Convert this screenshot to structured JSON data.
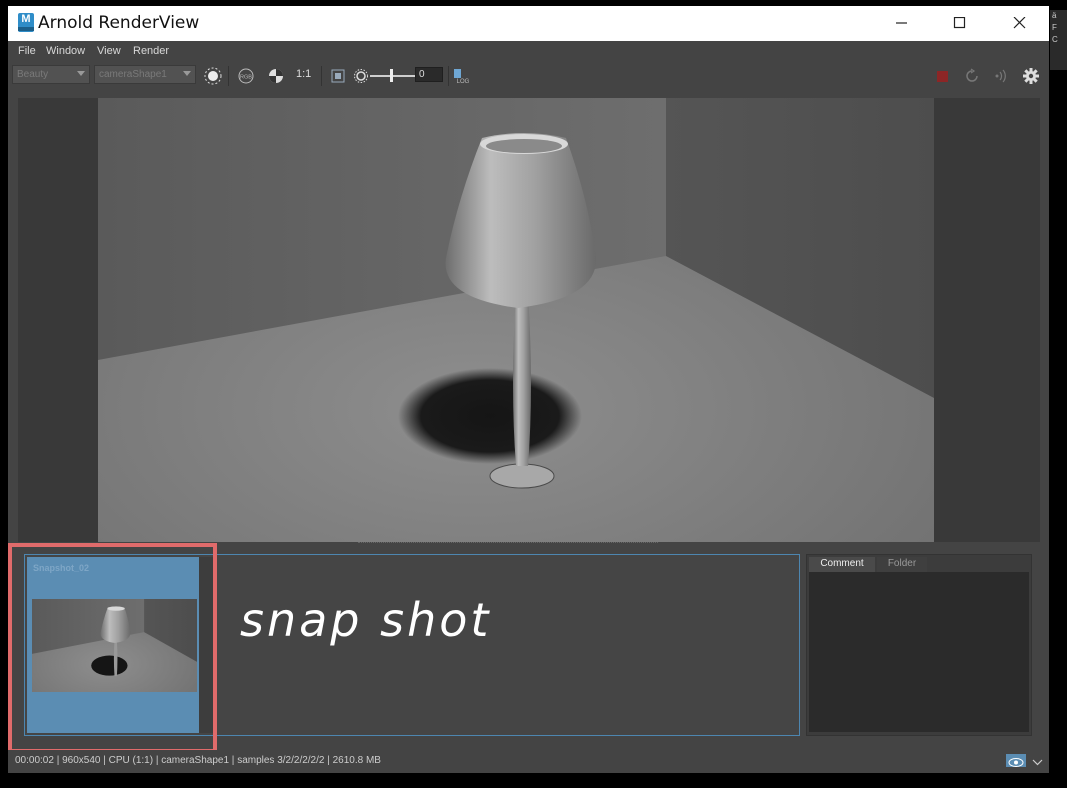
{
  "window": {
    "title": "Arnold RenderView",
    "logo_letter": "M",
    "controls": [
      "minimize-icon",
      "maximize-icon",
      "close-icon"
    ]
  },
  "menu": [
    "File",
    "Window",
    "View",
    "Render"
  ],
  "toolbar": {
    "aov_select": "Beauty",
    "camera_select": "cameraShape1",
    "zoom_label": "1:1",
    "exposure_value": "0",
    "log_label": "LOG",
    "icons": [
      "crop-region-icon",
      "rgb-channel-icon",
      "checker-icon",
      "fit-frame-icon",
      "exposure-icon",
      "log-icon",
      "stop-render-icon",
      "refresh-icon",
      "ipr-icon",
      "gear-icon"
    ]
  },
  "snapshots": {
    "items": [
      {
        "label": "Snapshot_02"
      }
    ],
    "annotation": "snap shot"
  },
  "side_panel": {
    "tabs": [
      "Comment",
      "Folder"
    ],
    "active_tab": "Comment"
  },
  "status": {
    "text": "00:00:02 |  960x540 | CPU (1:1) | cameraShape1 | samples 3/2/2/2/2/2 | 2610.8 MB"
  },
  "colors": {
    "accent": "#5b8db3",
    "highlight": "#e06b6b",
    "stop": "#8c2626"
  },
  "background_window_fragment": [
    "ä",
    "F",
    "C"
  ]
}
